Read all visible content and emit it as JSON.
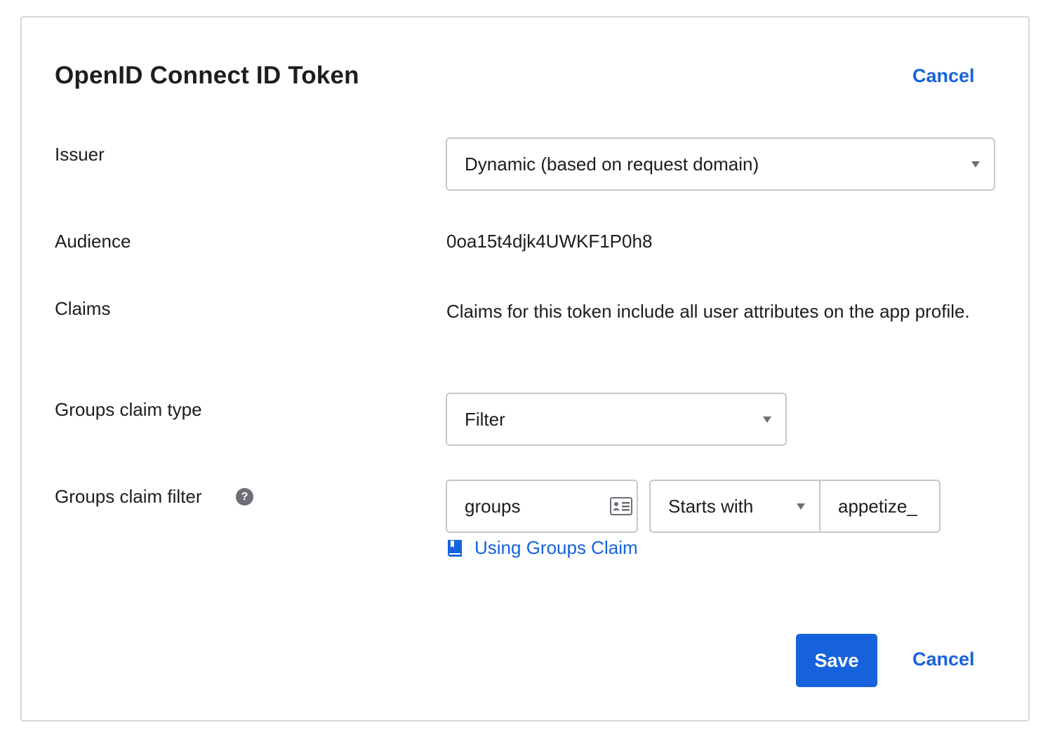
{
  "dialog": {
    "title": "OpenID Connect ID Token",
    "cancel_label": "Cancel"
  },
  "fields": {
    "issuer": {
      "label": "Issuer",
      "selected": "Dynamic (based on request domain)"
    },
    "audience": {
      "label": "Audience",
      "value": "0oa15t4djk4UWKF1P0h8"
    },
    "claims": {
      "label": "Claims",
      "value": "Claims for this token include all user attributes on the app profile."
    },
    "groups_claim_type": {
      "label": "Groups claim type",
      "selected": "Filter"
    },
    "groups_claim_filter": {
      "label": "Groups claim filter",
      "help_icon": "?",
      "claim_name": "groups",
      "operator": "Starts with",
      "filter_value": "appetize_",
      "help_link": "Using Groups Claim"
    }
  },
  "footer": {
    "save_label": "Save",
    "cancel_label": "Cancel"
  },
  "colors": {
    "accent": "#1662dd",
    "border": "#c6c6cd",
    "text": "#1d1d21",
    "icon_gray": "#6e6e78"
  },
  "icons": {
    "issuer_dropdown": "caret-down-icon",
    "claim_type_dropdown": "caret-down-icon",
    "operator_dropdown": "caret-down-icon",
    "claim_name_field": "contact-card-icon",
    "help": "question-circle-icon",
    "help_link": "book-icon"
  }
}
